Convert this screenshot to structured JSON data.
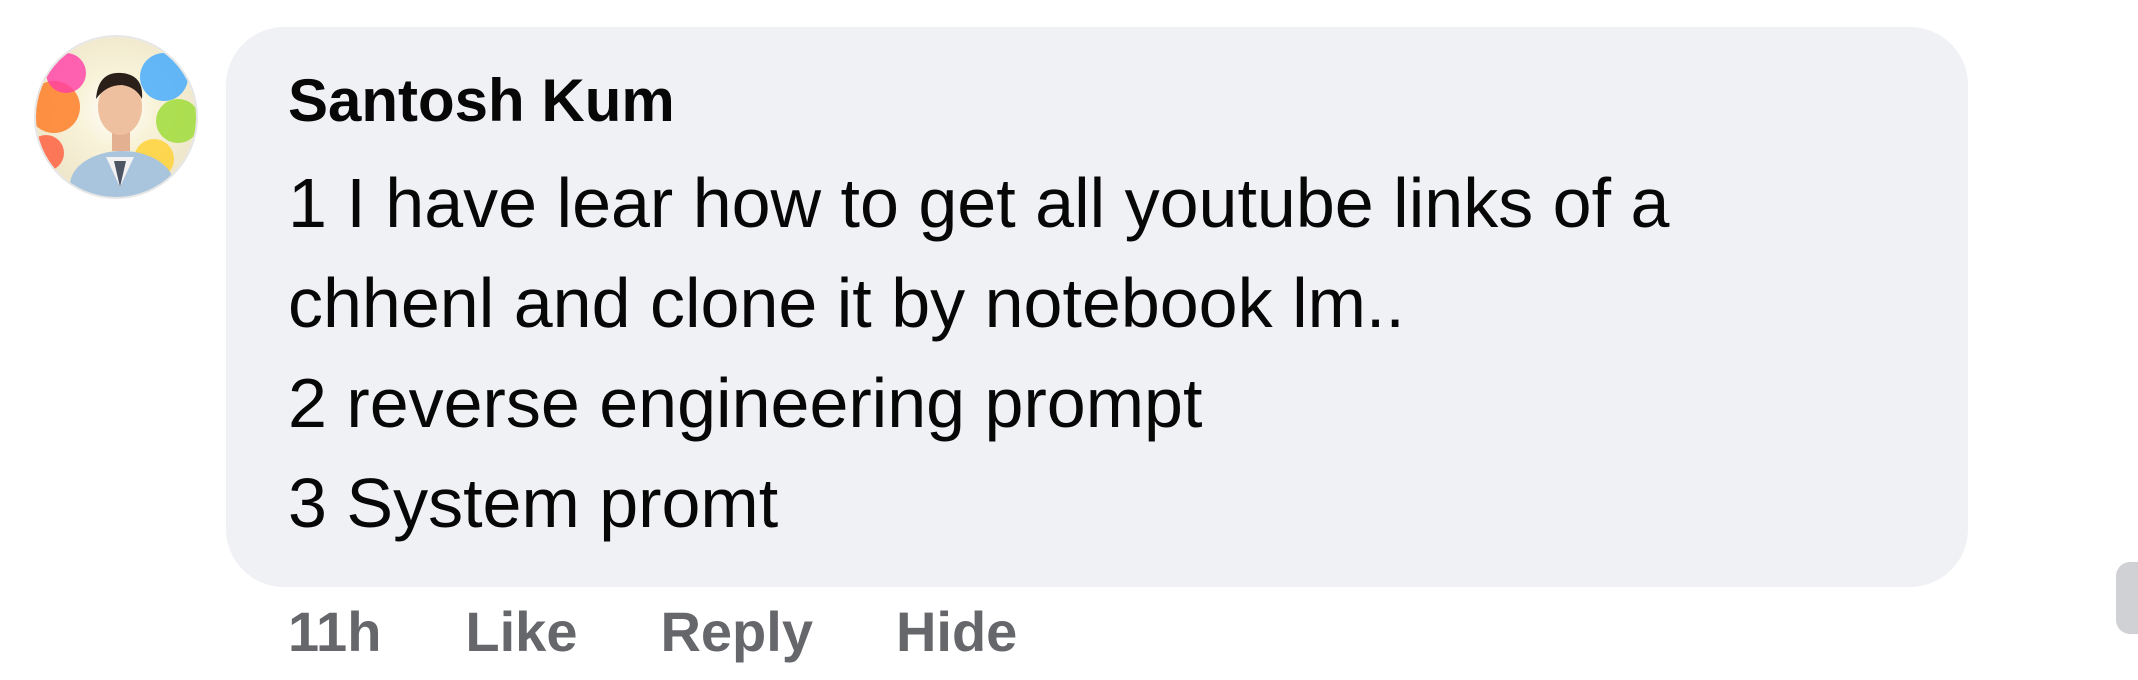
{
  "comment": {
    "author": "Santosh Kum",
    "lines": [
      "1 I have lear how to get all youtube links of a",
      "chhenl and clone it by notebook lm..",
      "2 reverse engineering prompt",
      "3 System promt"
    ]
  },
  "actions": {
    "time": "11h",
    "like_label": "Like",
    "reply_label": "Reply",
    "hide_label": "Hide"
  },
  "colors": {
    "bubble": "#f0f1f5",
    "text": "#070707",
    "action_text": "#65676b"
  },
  "icons": {
    "avatar": "user-avatar-photo"
  }
}
